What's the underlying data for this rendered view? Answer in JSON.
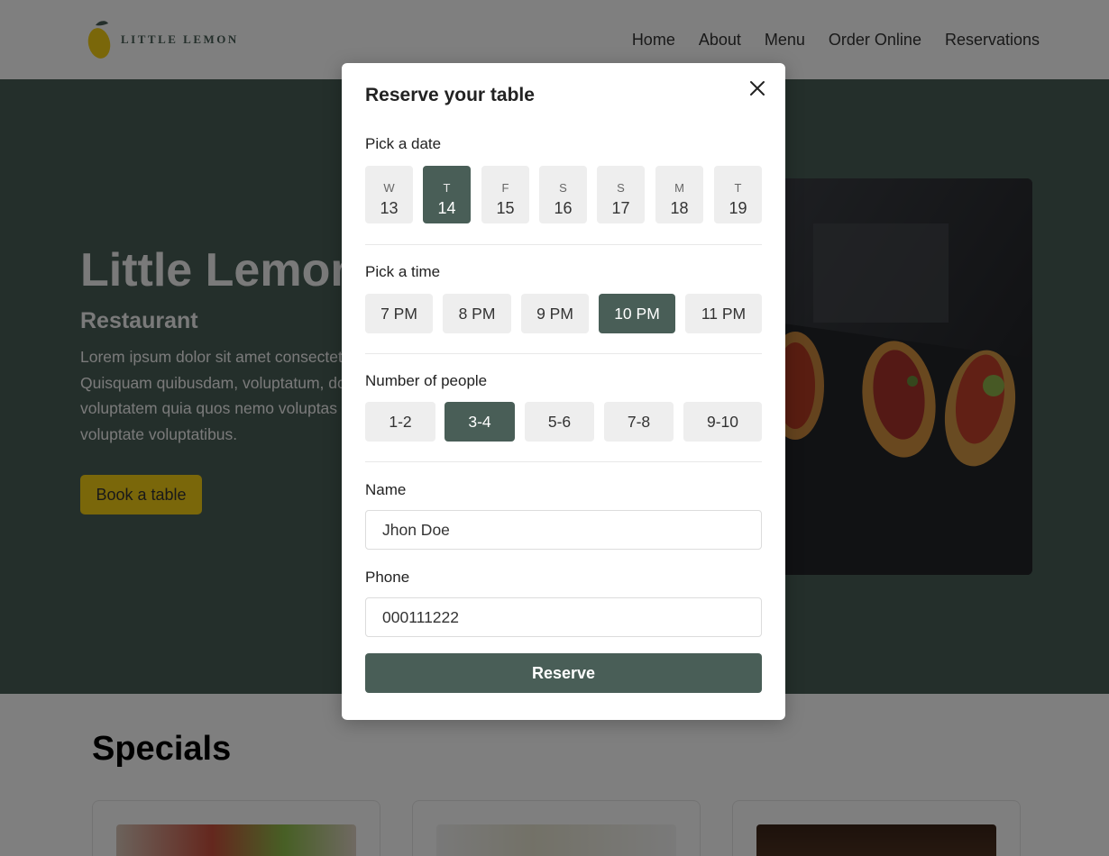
{
  "header": {
    "logo_text": "LITTLE LEMON",
    "nav": [
      "Home",
      "About",
      "Menu",
      "Order Online",
      "Reservations"
    ]
  },
  "hero": {
    "title": "Little Lemon",
    "subtitle": "Restaurant",
    "description": "Lorem ipsum dolor sit amet consectetur\nQuisquam quibusdam, voluptatum, dolor\nvoluptatem quia quos nemo voluptas\nvoluptate voluptatibus.",
    "button_label": "Book a table"
  },
  "specials": {
    "title": "Specials"
  },
  "modal": {
    "title": "Reserve your table",
    "date_label": "Pick a date",
    "dates": [
      {
        "dow": "W",
        "day": "13"
      },
      {
        "dow": "T",
        "day": "14"
      },
      {
        "dow": "F",
        "day": "15"
      },
      {
        "dow": "S",
        "day": "16"
      },
      {
        "dow": "S",
        "day": "17"
      },
      {
        "dow": "M",
        "day": "18"
      },
      {
        "dow": "T",
        "day": "19"
      }
    ],
    "selected_date_index": 1,
    "time_label": "Pick a time",
    "times": [
      "7 PM",
      "8 PM",
      "9 PM",
      "10 PM",
      "11 PM"
    ],
    "selected_time_index": 3,
    "people_label": "Number of people",
    "people": [
      "1-2",
      "3-4",
      "5-6",
      "7-8",
      "9-10"
    ],
    "selected_people_index": 1,
    "name_label": "Name",
    "name_value": "Jhon Doe",
    "phone_label": "Phone",
    "phone_value": "000111222",
    "reserve_label": "Reserve"
  },
  "colors": {
    "primary": "#495e57",
    "accent": "#f4ce14",
    "pill_bg": "#eeeeee"
  }
}
